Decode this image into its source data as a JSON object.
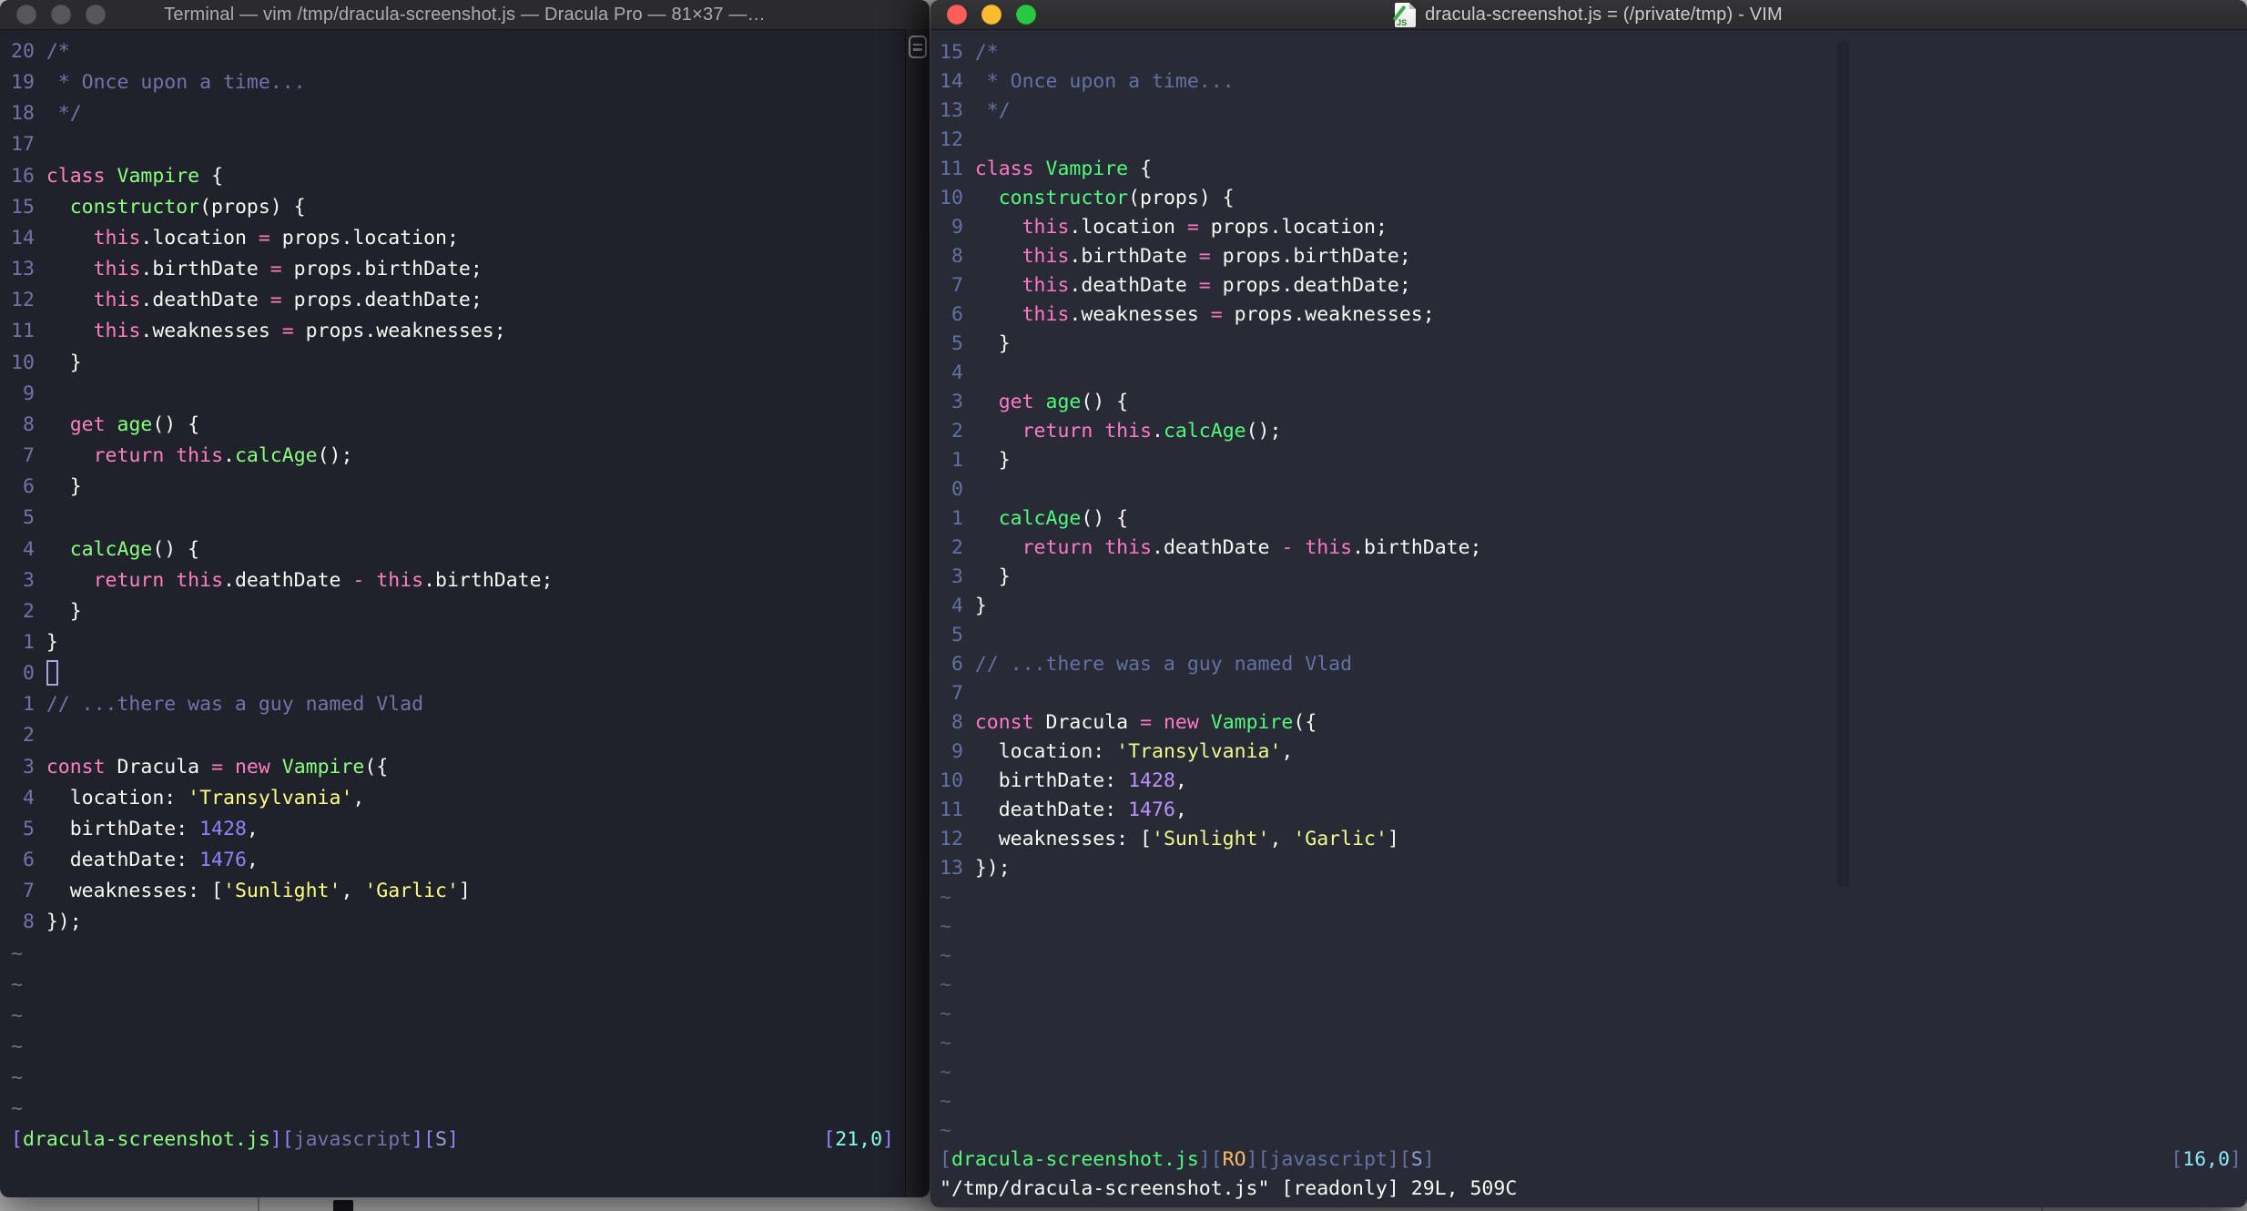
{
  "left_window": {
    "title": "Terminal — vim /tmp/dracula-screenshot.js — Dracula Pro — 81×37 —…",
    "traffic_lights": [
      "#56575B",
      "#56575B",
      "#56575B"
    ],
    "theme": {
      "bg": "#1F212B",
      "gutter": "#7970A9",
      "c": "#7970A9",
      "p": "#FF80BF",
      "g": "#8AFF80",
      "y": "#FFFF80",
      "n": "#9580FF",
      "f": "#F8F8F2",
      "tilde": "#6E6F7D",
      "cursor": "#A9A4D9",
      "punct": "#9580FF",
      "file": "#8AFF80",
      "lang": "#7970A9",
      "flag": "#9BA2D8",
      "pos": "#80FFEA"
    },
    "tilde_count": 6,
    "status_tokens": [
      [
        "punct",
        "["
      ],
      [
        "file",
        "dracula-screenshot.js"
      ],
      [
        "punct",
        "]["
      ],
      [
        "lang",
        "javascript"
      ],
      [
        "punct",
        "]["
      ],
      [
        "flag",
        "S"
      ],
      [
        "punct",
        "]"
      ]
    ],
    "pos_tokens": [
      [
        "punct",
        "["
      ],
      [
        "pos",
        "21,0"
      ],
      [
        "punct",
        "]"
      ]
    ],
    "command_line": "",
    "lines": [
      {
        "n": "20",
        "tokens": [
          [
            "c",
            "/*"
          ]
        ]
      },
      {
        "n": "19",
        "tokens": [
          [
            "c",
            " * Once upon a time..."
          ]
        ]
      },
      {
        "n": "18",
        "tokens": [
          [
            "c",
            " */"
          ]
        ]
      },
      {
        "n": "17",
        "tokens": []
      },
      {
        "n": "16",
        "tokens": [
          [
            "p",
            "class"
          ],
          [
            "f",
            " "
          ],
          [
            "g",
            "Vampire"
          ],
          [
            "f",
            " {"
          ]
        ]
      },
      {
        "n": "15",
        "tokens": [
          [
            "f",
            "  "
          ],
          [
            "g",
            "constructor"
          ],
          [
            "f",
            "(props) {"
          ]
        ]
      },
      {
        "n": "14",
        "tokens": [
          [
            "f",
            "    "
          ],
          [
            "p",
            "this"
          ],
          [
            "f",
            ".location "
          ],
          [
            "p",
            "="
          ],
          [
            "f",
            " props.location;"
          ]
        ]
      },
      {
        "n": "13",
        "tokens": [
          [
            "f",
            "    "
          ],
          [
            "p",
            "this"
          ],
          [
            "f",
            ".birthDate "
          ],
          [
            "p",
            "="
          ],
          [
            "f",
            " props.birthDate;"
          ]
        ]
      },
      {
        "n": "12",
        "tokens": [
          [
            "f",
            "    "
          ],
          [
            "p",
            "this"
          ],
          [
            "f",
            ".deathDate "
          ],
          [
            "p",
            "="
          ],
          [
            "f",
            " props.deathDate;"
          ]
        ]
      },
      {
        "n": "11",
        "tokens": [
          [
            "f",
            "    "
          ],
          [
            "p",
            "this"
          ],
          [
            "f",
            ".weaknesses "
          ],
          [
            "p",
            "="
          ],
          [
            "f",
            " props.weaknesses;"
          ]
        ]
      },
      {
        "n": "10",
        "tokens": [
          [
            "f",
            "  }"
          ]
        ]
      },
      {
        "n": " 9",
        "tokens": []
      },
      {
        "n": " 8",
        "tokens": [
          [
            "f",
            "  "
          ],
          [
            "p",
            "get"
          ],
          [
            "f",
            " "
          ],
          [
            "g",
            "age"
          ],
          [
            "f",
            "() {"
          ]
        ]
      },
      {
        "n": " 7",
        "tokens": [
          [
            "f",
            "    "
          ],
          [
            "p",
            "return"
          ],
          [
            "f",
            " "
          ],
          [
            "p",
            "this"
          ],
          [
            "f",
            "."
          ],
          [
            "g",
            "calcAge"
          ],
          [
            "f",
            "();"
          ]
        ]
      },
      {
        "n": " 6",
        "tokens": [
          [
            "f",
            "  }"
          ]
        ]
      },
      {
        "n": " 5",
        "tokens": []
      },
      {
        "n": " 4",
        "tokens": [
          [
            "f",
            "  "
          ],
          [
            "g",
            "calcAge"
          ],
          [
            "f",
            "() {"
          ]
        ]
      },
      {
        "n": " 3",
        "tokens": [
          [
            "f",
            "    "
          ],
          [
            "p",
            "return"
          ],
          [
            "f",
            " "
          ],
          [
            "p",
            "this"
          ],
          [
            "f",
            ".deathDate "
          ],
          [
            "p",
            "-"
          ],
          [
            "f",
            " "
          ],
          [
            "p",
            "this"
          ],
          [
            "f",
            ".birthDate;"
          ]
        ]
      },
      {
        "n": " 2",
        "tokens": [
          [
            "f",
            "  }"
          ]
        ]
      },
      {
        "n": " 1",
        "tokens": [
          [
            "f",
            "}"
          ]
        ]
      },
      {
        "n": " 0",
        "tokens": [
          [
            "cursor",
            ""
          ]
        ]
      },
      {
        "n": " 1",
        "tokens": [
          [
            "c",
            "// ...there was a guy named Vlad"
          ]
        ]
      },
      {
        "n": " 2",
        "tokens": []
      },
      {
        "n": " 3",
        "tokens": [
          [
            "p",
            "const"
          ],
          [
            "f",
            " Dracula "
          ],
          [
            "p",
            "="
          ],
          [
            "f",
            " "
          ],
          [
            "p",
            "new"
          ],
          [
            "f",
            " "
          ],
          [
            "g",
            "Vampire"
          ],
          [
            "f",
            "({"
          ]
        ]
      },
      {
        "n": " 4",
        "tokens": [
          [
            "f",
            "  location: "
          ],
          [
            "y",
            "'Transylvania'"
          ],
          [
            "f",
            ","
          ]
        ]
      },
      {
        "n": " 5",
        "tokens": [
          [
            "f",
            "  birthDate: "
          ],
          [
            "n2",
            "1428"
          ],
          [
            "f",
            ","
          ]
        ]
      },
      {
        "n": " 6",
        "tokens": [
          [
            "f",
            "  deathDate: "
          ],
          [
            "n2",
            "1476"
          ],
          [
            "f",
            ","
          ]
        ]
      },
      {
        "n": " 7",
        "tokens": [
          [
            "f",
            "  weaknesses: ["
          ],
          [
            "y",
            "'Sunlight'"
          ],
          [
            "f",
            ", "
          ],
          [
            "y",
            "'Garlic'"
          ],
          [
            "f",
            "]"
          ]
        ]
      },
      {
        "n": " 8",
        "tokens": [
          [
            "f",
            "});"
          ]
        ]
      }
    ]
  },
  "right_window": {
    "title": "dracula-screenshot.js = (/private/tmp) - VIM",
    "doc_icon": "js-document-icon",
    "traffic_lights": [
      "#FF5F57",
      "#FEBC2E",
      "#28C840"
    ],
    "theme": {
      "bg": "#282A36",
      "gutter": "#6272A4",
      "c": "#6272A4",
      "p": "#FF79C6",
      "g": "#50FA7B",
      "y": "#F1FA8C",
      "n": "#BD93F9",
      "f": "#F8F8F2",
      "tilde": "#565C78",
      "cursor": "#F8F8F2",
      "punct": "#6272A4",
      "file": "#50FA7B",
      "ro": "#FFB86C",
      "lang": "#6272A4",
      "flag": "#8FA0CF",
      "pos": "#8BE9FD"
    },
    "tilde_count": 9,
    "status_tokens": [
      [
        "punct",
        "["
      ],
      [
        "file",
        "dracula-screenshot.js"
      ],
      [
        "punct",
        "]["
      ],
      [
        "ro",
        "RO"
      ],
      [
        "punct",
        "]["
      ],
      [
        "lang",
        "javascript"
      ],
      [
        "punct",
        "]["
      ],
      [
        "flag",
        "S"
      ],
      [
        "punct",
        "]"
      ]
    ],
    "pos_tokens": [
      [
        "punct",
        "["
      ],
      [
        "pos",
        "16,0"
      ],
      [
        "punct",
        "]"
      ]
    ],
    "command_line": "\"/tmp/dracula-screenshot.js\" [readonly] 29L, 509C",
    "lines": [
      {
        "n": "15",
        "tokens": [
          [
            "c",
            "/*"
          ]
        ]
      },
      {
        "n": "14",
        "tokens": [
          [
            "c",
            " * Once upon a time..."
          ]
        ]
      },
      {
        "n": "13",
        "tokens": [
          [
            "c",
            " */"
          ]
        ]
      },
      {
        "n": "12",
        "tokens": []
      },
      {
        "n": "11",
        "tokens": [
          [
            "p",
            "class"
          ],
          [
            "f",
            " "
          ],
          [
            "g",
            "Vampire"
          ],
          [
            "f",
            " {"
          ]
        ]
      },
      {
        "n": "10",
        "tokens": [
          [
            "f",
            "  "
          ],
          [
            "g",
            "constructor"
          ],
          [
            "f",
            "(props) {"
          ]
        ]
      },
      {
        "n": " 9",
        "tokens": [
          [
            "f",
            "    "
          ],
          [
            "p",
            "this"
          ],
          [
            "f",
            ".location "
          ],
          [
            "p",
            "="
          ],
          [
            "f",
            " props.location;"
          ]
        ]
      },
      {
        "n": " 8",
        "tokens": [
          [
            "f",
            "    "
          ],
          [
            "p",
            "this"
          ],
          [
            "f",
            ".birthDate "
          ],
          [
            "p",
            "="
          ],
          [
            "f",
            " props.birthDate;"
          ]
        ]
      },
      {
        "n": " 7",
        "tokens": [
          [
            "f",
            "    "
          ],
          [
            "p",
            "this"
          ],
          [
            "f",
            ".deathDate "
          ],
          [
            "p",
            "="
          ],
          [
            "f",
            " props.deathDate;"
          ]
        ]
      },
      {
        "n": " 6",
        "tokens": [
          [
            "f",
            "    "
          ],
          [
            "p",
            "this"
          ],
          [
            "f",
            ".weaknesses "
          ],
          [
            "p",
            "="
          ],
          [
            "f",
            " props.weaknesses;"
          ]
        ]
      },
      {
        "n": " 5",
        "tokens": [
          [
            "f",
            "  }"
          ]
        ]
      },
      {
        "n": " 4",
        "tokens": []
      },
      {
        "n": " 3",
        "tokens": [
          [
            "f",
            "  "
          ],
          [
            "p",
            "get"
          ],
          [
            "f",
            " "
          ],
          [
            "g",
            "age"
          ],
          [
            "f",
            "() {"
          ]
        ]
      },
      {
        "n": " 2",
        "tokens": [
          [
            "f",
            "    "
          ],
          [
            "p",
            "return"
          ],
          [
            "f",
            " "
          ],
          [
            "p",
            "this"
          ],
          [
            "f",
            "."
          ],
          [
            "g",
            "calcAge"
          ],
          [
            "f",
            "();"
          ]
        ]
      },
      {
        "n": " 1",
        "tokens": [
          [
            "f",
            "  }"
          ]
        ]
      },
      {
        "n": " 0",
        "tokens": []
      },
      {
        "n": " 1",
        "tokens": [
          [
            "f",
            "  "
          ],
          [
            "g",
            "calcAge"
          ],
          [
            "f",
            "() {"
          ]
        ]
      },
      {
        "n": " 2",
        "tokens": [
          [
            "f",
            "    "
          ],
          [
            "p",
            "return"
          ],
          [
            "f",
            " "
          ],
          [
            "p",
            "this"
          ],
          [
            "f",
            ".deathDate "
          ],
          [
            "p",
            "-"
          ],
          [
            "f",
            " "
          ],
          [
            "p",
            "this"
          ],
          [
            "f",
            ".birthDate;"
          ]
        ]
      },
      {
        "n": " 3",
        "tokens": [
          [
            "f",
            "  }"
          ]
        ]
      },
      {
        "n": " 4",
        "tokens": [
          [
            "f",
            "}"
          ]
        ]
      },
      {
        "n": " 5",
        "tokens": []
      },
      {
        "n": " 6",
        "tokens": [
          [
            "c",
            "// ...there was a guy named Vlad"
          ]
        ]
      },
      {
        "n": " 7",
        "tokens": []
      },
      {
        "n": " 8",
        "tokens": [
          [
            "p",
            "const"
          ],
          [
            "f",
            " Dracula "
          ],
          [
            "p",
            "="
          ],
          [
            "f",
            " "
          ],
          [
            "p",
            "new"
          ],
          [
            "f",
            " "
          ],
          [
            "g",
            "Vampire"
          ],
          [
            "f",
            "({"
          ]
        ]
      },
      {
        "n": " 9",
        "tokens": [
          [
            "f",
            "  location: "
          ],
          [
            "y",
            "'Transylvania'"
          ],
          [
            "f",
            ","
          ]
        ]
      },
      {
        "n": "10",
        "tokens": [
          [
            "f",
            "  birthDate: "
          ],
          [
            "n2",
            "1428"
          ],
          [
            "f",
            ","
          ]
        ]
      },
      {
        "n": "11",
        "tokens": [
          [
            "f",
            "  deathDate: "
          ],
          [
            "n2",
            "1476"
          ],
          [
            "f",
            ","
          ]
        ]
      },
      {
        "n": "12",
        "tokens": [
          [
            "f",
            "  weaknesses: ["
          ],
          [
            "y",
            "'Sunlight'"
          ],
          [
            "f",
            ", "
          ],
          [
            "y",
            "'Garlic'"
          ],
          [
            "f",
            "]"
          ]
        ]
      },
      {
        "n": "13",
        "tokens": [
          [
            "f",
            "});"
          ]
        ]
      }
    ]
  }
}
